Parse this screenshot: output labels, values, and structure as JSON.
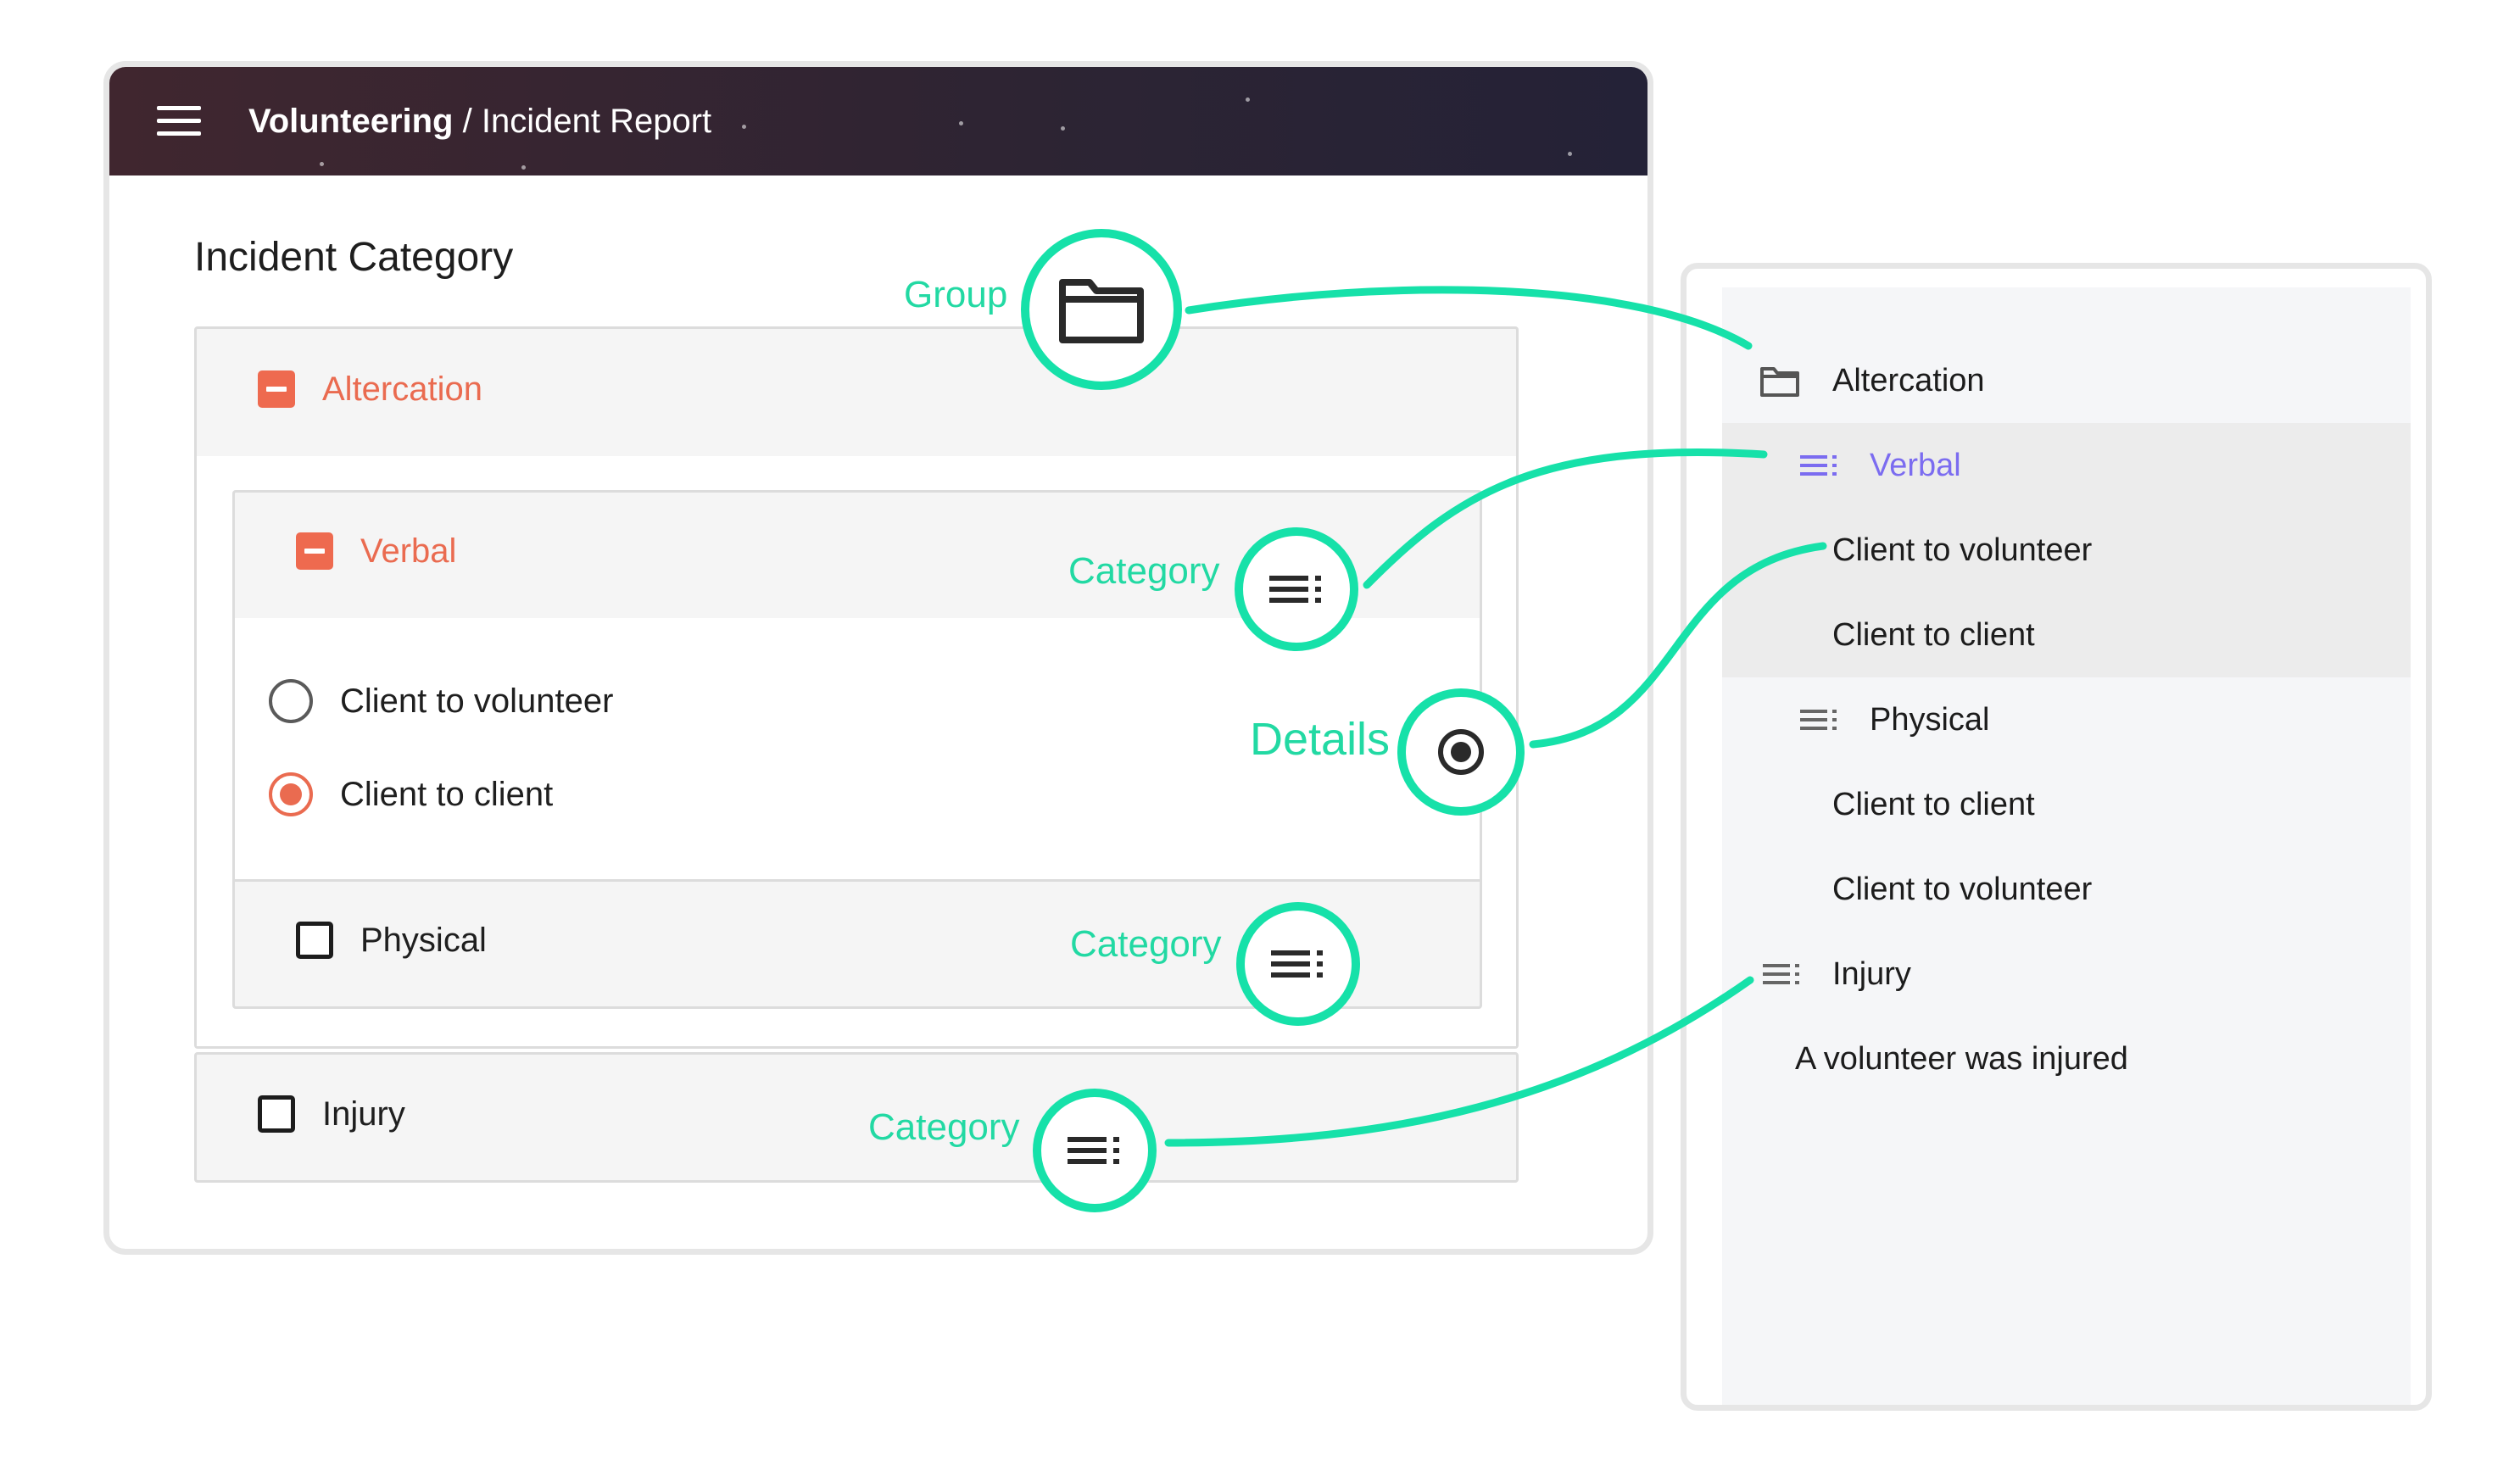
{
  "header": {
    "app_name": "Volunteering",
    "separator": "/",
    "page_name": "Incident Report"
  },
  "form": {
    "title": "Incident Category",
    "groups": [
      {
        "label": "Altercation",
        "state": "expanded"
      },
      {
        "label": "Verbal",
        "state": "expanded"
      },
      {
        "label": "Physical",
        "state": "unchecked"
      },
      {
        "label": "Injury",
        "state": "unchecked"
      }
    ],
    "radio_options": [
      {
        "label": "Client to volunteer",
        "selected": false
      },
      {
        "label": "Client to client",
        "selected": true
      }
    ]
  },
  "callouts": {
    "group": "Group",
    "category_1": "Category",
    "details": "Details",
    "category_2": "Category",
    "category_3": "Category"
  },
  "tree": {
    "items": [
      {
        "label": "Altercation",
        "icon": "folder-icon"
      },
      {
        "label": "Verbal",
        "icon": "category-list-icon",
        "highlighted": true
      },
      {
        "label": "Client to volunteer"
      },
      {
        "label": "Client to client"
      },
      {
        "label": "Physical",
        "icon": "category-list-icon"
      },
      {
        "label": "Client to client"
      },
      {
        "label": "Client to volunteer"
      },
      {
        "label": "Injury",
        "icon": "category-list-icon"
      },
      {
        "label": "A volunteer was injured"
      }
    ]
  },
  "colors": {
    "accent": "#ea6b50",
    "callout": "#16e1a9",
    "tree_selected": "#7b6cf0",
    "topbar": "#2d2433"
  }
}
